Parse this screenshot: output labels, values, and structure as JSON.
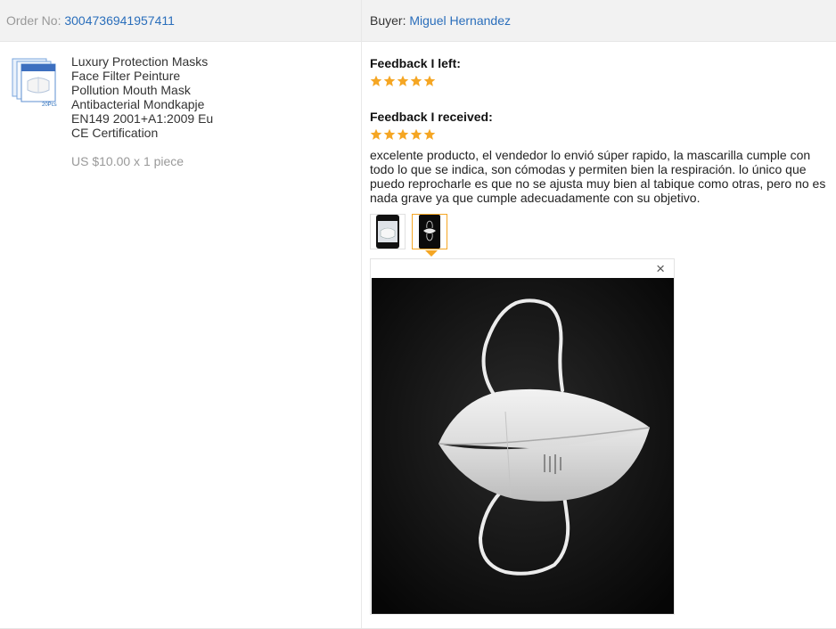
{
  "header": {
    "order_label": "Order No:",
    "order_number": "3004736941957411",
    "buyer_label": "Buyer:",
    "buyer_name": "Miguel Hernandez"
  },
  "product": {
    "name": "Luxury Protection Masks Face Filter Peinture Pollution Mouth Mask Antibacterial Mondkapje EN149 2001+A1:2009 Eu CE Certification",
    "price_line": "US $10.00 x 1 piece",
    "thumb_badge": "20Pcs",
    "thumb_icon": "mask-package-icon"
  },
  "feedback_left": {
    "title": "Feedback I left:",
    "rating": 5
  },
  "feedback_received": {
    "title": "Feedback I received:",
    "rating": 5,
    "comment": "excelente producto, el vendedor lo envió súper rapido, la mascarilla cumple con todo lo que se indica, son cómodas y permiten bien la respiración. lo único que puedo reprocharle es que no se ajusta muy bien al tabique como otras, pero no es nada grave ya que cumple adecuadamente con su objetivo."
  },
  "photos": {
    "count": 2,
    "selected_index": 2,
    "close_symbol": "×"
  },
  "colors": {
    "link": "#2a6ebb",
    "star": "#f5a623",
    "header_bg": "#f2f2f2",
    "muted_text": "#999999"
  }
}
